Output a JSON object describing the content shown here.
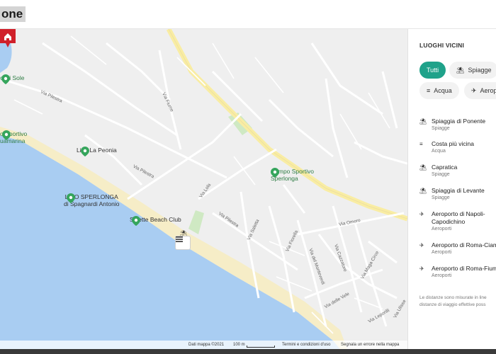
{
  "header": {
    "title": "one"
  },
  "map": {
    "labels": {
      "di_sole": "o Di Sole",
      "via_pilestra_1": "Via Pilestra",
      "via_fiume": "Via Fiume",
      "sportivo_left": "o Sportivo",
      "quamarina": "uamarina",
      "lido_peonia": "Lido La Peonia",
      "via_pilestra_2": "Via Pilestra",
      "lido_sperlonga_1": "LIDO SPERLONGA",
      "lido_sperlonga_2": "di Spagnardi Antonio",
      "salette": "Salette Beach Club",
      "via_lola": "Via Lola",
      "via_pilestra_3": "Via Pilestra",
      "via_saletta": "Via Saletta",
      "campo_1": "Campo Sportivo",
      "campo_2": "Sperlonga",
      "via_fiorella": "Via Fiorella",
      "via_omero": "Via Omero",
      "via_monteverdi": "Via del Monteverdi",
      "via_cazzatore": "Via Cazzatore",
      "via_mega_circe": "Via Maga Circe",
      "via_delle_vele": "Via delle Vele",
      "via_leporilli": "Via Leporilli",
      "via_ulisse": "Via Ulisse"
    },
    "footer": {
      "data": "Dati mappa ©2021",
      "scale": "100 m",
      "terms": "Termini e condizioni d'uso",
      "report": "Segnala un errore nella mappa"
    },
    "colors": {
      "sea": "#a9cdf2",
      "beach": "#f6edc7",
      "road_main": "#f9eda3",
      "green": "#cfe9c3",
      "home": "#d0202a",
      "pin": "#35a55c"
    }
  },
  "panel": {
    "title": "LUOGHI VICINI",
    "filters": [
      {
        "label": "Tutti",
        "icon": "",
        "active": true
      },
      {
        "label": "Spiagge",
        "icon": "beach-icon",
        "active": false
      },
      {
        "label": "Acqua",
        "icon": "water-icon",
        "active": false
      },
      {
        "label": "Aeroporti",
        "icon": "airplane-icon",
        "active": false
      }
    ],
    "places": [
      {
        "name": "Spiaggia di Ponente",
        "category": "Spiagge",
        "icon": "beach-icon"
      },
      {
        "name": "Costa più vicina",
        "category": "Acqua",
        "icon": "water-icon"
      },
      {
        "name": "Capratica",
        "category": "Spiagge",
        "icon": "beach-icon"
      },
      {
        "name": "Spiaggia di Levante",
        "category": "Spiagge",
        "icon": "beach-icon"
      },
      {
        "name": "Aeroporto di Napoli-",
        "name2": "Capodichino",
        "category": "Aeroporti",
        "icon": "airplane-icon"
      },
      {
        "name": "Aeroporto di Roma-Ciam",
        "category": "Aeroporti",
        "icon": "airplane-icon"
      },
      {
        "name": "Aeroporto di Roma-Fium",
        "category": "Aeroporti",
        "icon": "airplane-icon"
      }
    ],
    "note_1": "Le distanze sono misurate in line",
    "note_2": "distanze di viaggio effettive poss"
  }
}
